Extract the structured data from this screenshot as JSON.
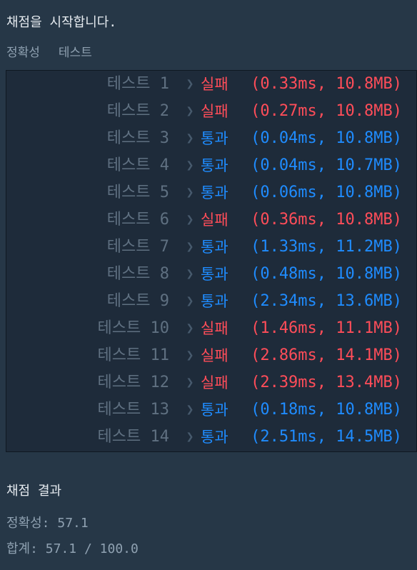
{
  "header": {
    "message": "채점을 시작합니다."
  },
  "tabs": [
    {
      "label": "정확성"
    },
    {
      "label": "테스트"
    }
  ],
  "results": [
    {
      "label": "테스트 1",
      "status": "실패",
      "detail": "(0.33ms, 10.8MB)",
      "state": "fail"
    },
    {
      "label": "테스트 2",
      "status": "실패",
      "detail": "(0.27ms, 10.8MB)",
      "state": "fail"
    },
    {
      "label": "테스트 3",
      "status": "통과",
      "detail": "(0.04ms, 10.8MB)",
      "state": "pass"
    },
    {
      "label": "테스트 4",
      "status": "통과",
      "detail": "(0.04ms, 10.7MB)",
      "state": "pass"
    },
    {
      "label": "테스트 5",
      "status": "통과",
      "detail": "(0.06ms, 10.8MB)",
      "state": "pass"
    },
    {
      "label": "테스트 6",
      "status": "실패",
      "detail": "(0.36ms, 10.8MB)",
      "state": "fail"
    },
    {
      "label": "테스트 7",
      "status": "통과",
      "detail": "(1.33ms, 11.2MB)",
      "state": "pass"
    },
    {
      "label": "테스트 8",
      "status": "통과",
      "detail": "(0.48ms, 10.8MB)",
      "state": "pass"
    },
    {
      "label": "테스트 9",
      "status": "통과",
      "detail": "(2.34ms, 13.6MB)",
      "state": "pass"
    },
    {
      "label": "테스트 10",
      "status": "실패",
      "detail": "(1.46ms, 11.1MB)",
      "state": "fail"
    },
    {
      "label": "테스트 11",
      "status": "실패",
      "detail": "(2.86ms, 14.1MB)",
      "state": "fail"
    },
    {
      "label": "테스트 12",
      "status": "실패",
      "detail": "(2.39ms, 13.4MB)",
      "state": "fail"
    },
    {
      "label": "테스트 13",
      "status": "통과",
      "detail": "(0.18ms, 10.8MB)",
      "state": "pass"
    },
    {
      "label": "테스트 14",
      "status": "통과",
      "detail": "(2.51ms, 14.5MB)",
      "state": "pass"
    }
  ],
  "summary": {
    "title": "채점 결과",
    "accuracy": "정확성: 57.1",
    "total": "합계: 57.1 / 100.0"
  },
  "colors": {
    "background": "#263747",
    "panel": "#1e2b3a",
    "fail": "#ff4d59",
    "pass": "#1f8cff",
    "muted": "#5f7081"
  },
  "icons": {
    "row_chevron": "chevron-right-icon"
  }
}
